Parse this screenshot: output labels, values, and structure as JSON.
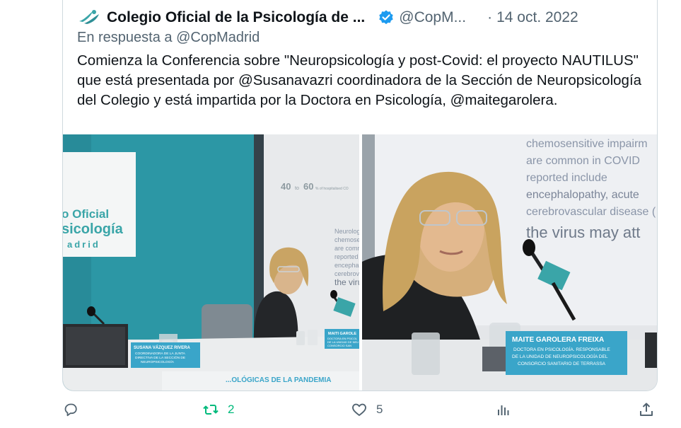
{
  "tweet": {
    "author_name": "Colegio Oficial de la Psicología de ...",
    "handle": "@CopM...",
    "separator": "·",
    "date": "14 oct. 2022",
    "reply_to": "En respuesta a @CopMadrid",
    "text": "Comienza la Conferencia sobre \"Neuropsicología y post-Covid: el proyecto NAUTILUS\" que está presentada por @Susanavazri coordinadora de la Sección de Neuropsicología del Colegio y está impartida por la Doctora en Psicología, @maitegarolera."
  },
  "media": {
    "left_photo": {
      "wall_sign": [
        "o Oficial",
        "sicología",
        "adrid"
      ],
      "slide_number": "40",
      "slide_to": "to",
      "slide_number2": "60",
      "slide_small": "% of hospitalised CO",
      "slide_words": [
        "Neurolog",
        "chemosen",
        "are comn",
        "reported",
        "encephalo",
        "cerebrova",
        "the viru"
      ],
      "name_card_left": [
        "SUSANA VÁZQUEZ RIVERA",
        "COORDINADORA DE LA JUNTA",
        "DIRECTIVA DE LA SECCIÓN DE",
        "NEUROPSICOLOGÍA"
      ],
      "name_card_right": [
        "MAITI GAROLE",
        "DOCTORA EN PSICOL",
        "DE LA UNIDAD DE NEU",
        "CONSORCIO SAN"
      ],
      "banner": "...OLÓGICAS DE LA PANDEMIA"
    },
    "right_photo": {
      "slide_lines": [
        "chemosensitive impairm",
        "are common in COVID",
        "reported      include",
        "encephalopathy,  acute",
        "cerebrovascular disease (",
        "the virus may att"
      ],
      "name_card": [
        "MAITE GAROLERA FREIXA",
        "DOCTORA EN PSICOLOGÍA. RESPONSABLE",
        "DE LA UNIDAD DE NEUROPSICOLOGÍA DEL",
        "CONSORCIO SANITARIO DE TERRASSA"
      ]
    }
  },
  "actions": {
    "reply_count": "",
    "retweet_count": "2",
    "like_count": "5"
  },
  "colors": {
    "accent": "#1d9bf0",
    "retweet": "#00ba7c",
    "muted": "#536471",
    "teal_wall": "#2f98a6",
    "card_blue": "#3aa5c9"
  },
  "icons": [
    "logo-icon",
    "verified-badge-icon",
    "reply-icon",
    "retweet-icon",
    "like-icon",
    "views-icon",
    "share-icon"
  ]
}
